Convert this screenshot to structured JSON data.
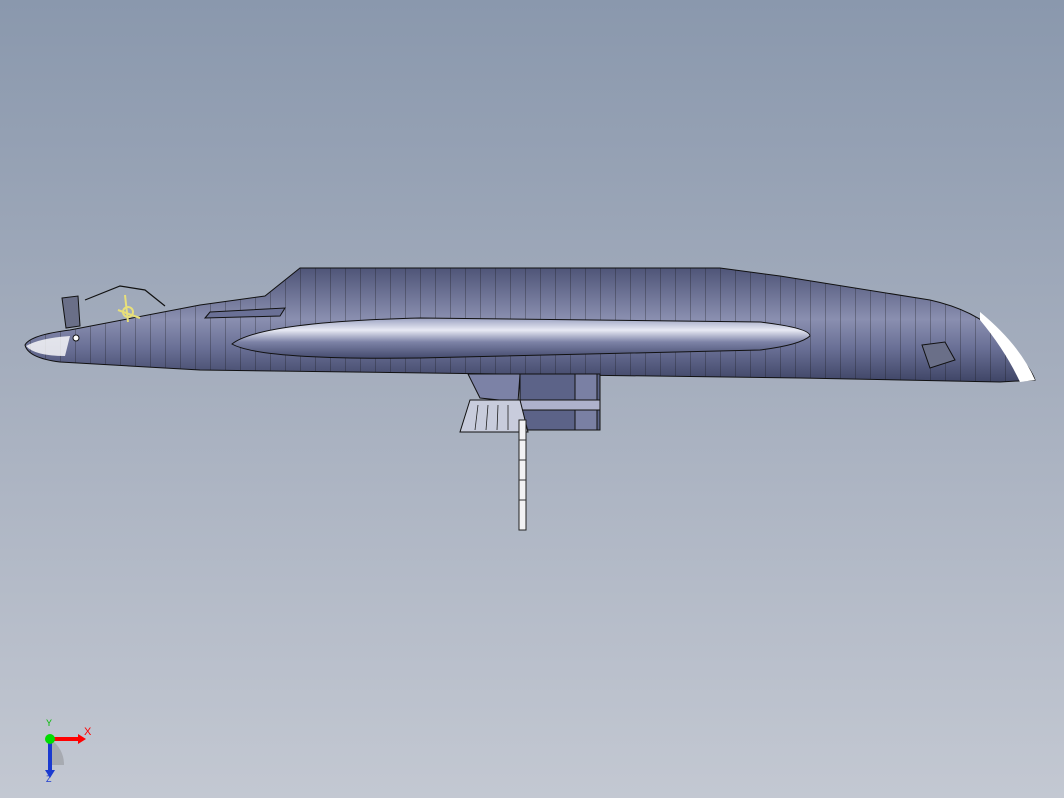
{
  "viewport": {
    "background_top": "#8a98ad",
    "background_bottom": "#c3c8d2",
    "model_color": "#5c6388"
  },
  "triad": {
    "x_label": "X",
    "y_label": "Y",
    "z_label": "Z",
    "x_color": "#ff0000",
    "y_color": "#00cc00",
    "z_color": "#1a3ad0"
  }
}
